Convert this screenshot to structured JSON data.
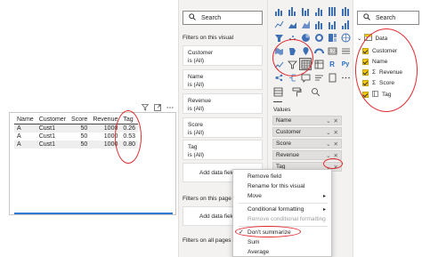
{
  "filters": {
    "search_placeholder": "Search",
    "section_visual": "Filters on this visual",
    "cards": [
      {
        "name": "Customer",
        "value": "is (All)"
      },
      {
        "name": "Name",
        "value": "is (All)"
      },
      {
        "name": "Revenue",
        "value": "is (All)"
      },
      {
        "name": "Score",
        "value": "is (All)"
      },
      {
        "name": "Tag",
        "value": "is (All)"
      }
    ],
    "add_data_fields": "Add data field",
    "section_page": "Filters on this page",
    "add_data_fields_page": "Add data field",
    "section_all": "Filters on all pages"
  },
  "table": {
    "headers": [
      "Name",
      "Customer",
      "Score",
      "Revenue",
      "Tag"
    ],
    "rows": [
      [
        "A",
        "Cust1",
        "50",
        "1000",
        "0.26"
      ],
      [
        "A",
        "Cust1",
        "50",
        "1000",
        "0.53"
      ],
      [
        "A",
        "Cust1",
        "50",
        "1000",
        "0.80"
      ]
    ]
  },
  "visualizations": {
    "values_label": "Values",
    "wells": [
      "Name",
      "Customer",
      "Score",
      "Revenue",
      "Tag"
    ],
    "grid_labels": {
      "r": "R",
      "py": "Py"
    }
  },
  "fields": {
    "search_placeholder": "Search",
    "table_name": "Data",
    "items": [
      "Customer",
      "Name",
      "Revenue",
      "Score",
      "Tag"
    ]
  },
  "context_menu": {
    "remove_field": "Remove field",
    "rename": "Rename for this visual",
    "move": "Move",
    "conditional_formatting": "Conditional formatting",
    "remove_conditional": "Remove conditional formatting",
    "dont_summarize": "Don't summarize",
    "sum": "Sum",
    "average": "Average"
  }
}
